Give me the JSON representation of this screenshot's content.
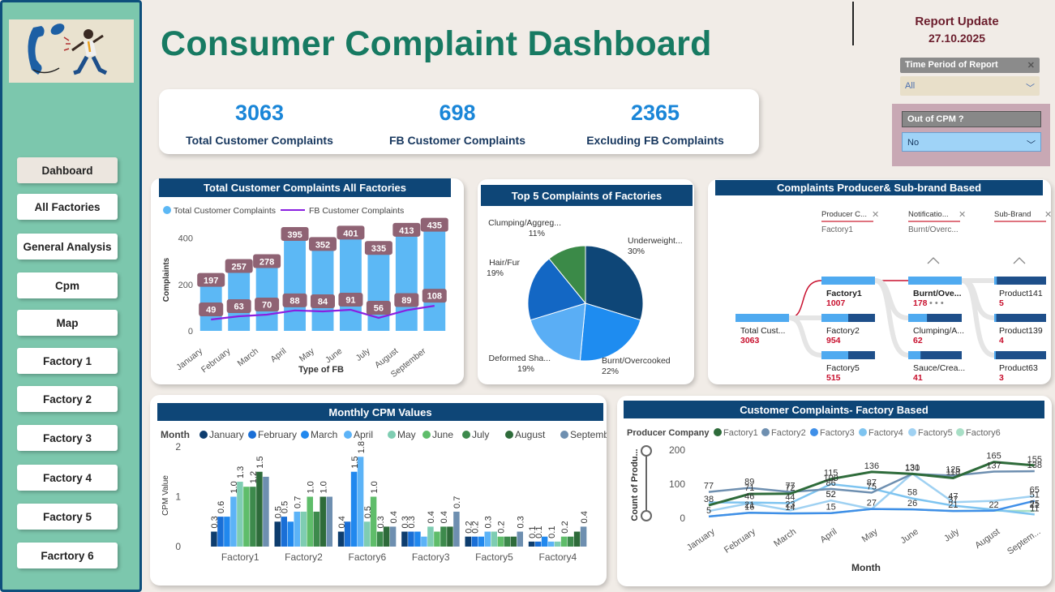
{
  "header": {
    "title": "Consumer Complaint Dashboard",
    "report_update_label": "Report Update",
    "report_date": "27.10.2025"
  },
  "nav": {
    "items": [
      "Dahboard",
      "All Factories",
      "General Analysis",
      "Cpm",
      "Map",
      "Factory 1",
      "Factory 2",
      "Factory 3",
      "Factory 4",
      "Factory 5",
      "Facrtory 6"
    ],
    "active": "Dahboard"
  },
  "slicers": {
    "time_period": {
      "label": "Time Period of Report",
      "value": "All"
    },
    "out_of_cpm": {
      "label": "Out of CPM ?",
      "value": "No"
    }
  },
  "kpis": [
    {
      "value": "3063",
      "label": "Total Customer Complaints"
    },
    {
      "value": "698",
      "label": "FB Customer Complaints"
    },
    {
      "value": "2365",
      "label": "Excluding FB Complaints"
    }
  ],
  "colors": {
    "title": "#177a62",
    "kpi_value": "#1a86d8",
    "header_bar": "#0e4677",
    "sidebar": "#7cc7ad",
    "report": "#6b1d2c"
  },
  "chart_data": [
    {
      "type": "bar",
      "title": "Total Customer Complaints All Factories",
      "xlabel": "Type of FB",
      "ylabel": "Complaints",
      "categories": [
        "January",
        "February",
        "March",
        "April",
        "May",
        "June",
        "July",
        "August",
        "September"
      ],
      "series": [
        {
          "name": "Total Customer Complaints",
          "values": [
            197,
            257,
            278,
            395,
            352,
            401,
            335,
            413,
            435
          ],
          "color": "#5cb8f5"
        },
        {
          "name": "FB Customer Complaints",
          "values": [
            49,
            63,
            70,
            88,
            84,
            91,
            56,
            89,
            108
          ],
          "color": "#8a1fe0",
          "type": "line"
        }
      ],
      "yticks": [
        0,
        200,
        400
      ],
      "ylim": [
        0,
        500
      ],
      "legend": "top-left"
    },
    {
      "type": "pie",
      "title": "Top 5 Complaints of Factories",
      "slices": [
        {
          "label": "Underweight...",
          "value": 30,
          "pct": "30%",
          "color": "#0e4677"
        },
        {
          "label": "Burnt/Overcooked",
          "value": 22,
          "pct": "22%",
          "color": "#1e8cf0"
        },
        {
          "label": "Deformed Sha...",
          "value": 19,
          "pct": "19%",
          "color": "#5aaef5"
        },
        {
          "label": "Hair/Fur",
          "value": 19,
          "pct": "19%",
          "color": "#1367c4"
        },
        {
          "label": "Clumping/Aggreg...",
          "value": 11,
          "pct": "11%",
          "color": "#3b8a48"
        }
      ]
    },
    {
      "type": "bar",
      "title": "Monthly CPM Values",
      "ylabel": "CPM Value",
      "legend_title": "Month",
      "categories": [
        "Factory1",
        "Factory2",
        "Factory6",
        "Factory3",
        "Factory5",
        "Factory4"
      ],
      "series": [
        {
          "name": "January",
          "color": "#0e3d6e",
          "values": [
            0.3,
            0.5,
            0.3,
            0.3,
            0.2,
            0.1
          ]
        },
        {
          "name": "February",
          "color": "#1a6fd6",
          "values": [
            0.6,
            0.6,
            0.5,
            0.3,
            0.2,
            0.1
          ]
        },
        {
          "name": "March",
          "color": "#2188ee",
          "values": [
            0.6,
            0.5,
            1.5,
            0.3,
            0.2,
            0.2
          ]
        },
        {
          "name": "April",
          "color": "#5cb3f7",
          "values": [
            1.0,
            0.7,
            1.8,
            0.2,
            0.3,
            0.1
          ]
        },
        {
          "name": "May",
          "color": "#7fcdb2",
          "values": [
            1.3,
            0.7,
            0.5,
            0.4,
            0.3,
            0.1
          ]
        },
        {
          "name": "June",
          "color": "#5fbd6a",
          "values": [
            1.2,
            1.0,
            1.0,
            0.3,
            0.2,
            0.2
          ]
        },
        {
          "name": "July",
          "color": "#3d8a4c",
          "values": [
            1.2,
            0.7,
            0.3,
            0.4,
            0.2,
            0.2
          ]
        },
        {
          "name": "August",
          "color": "#2e6b3a",
          "values": [
            1.5,
            1.0,
            0.4,
            0.4,
            0.2,
            0.3
          ]
        },
        {
          "name": "September",
          "color": "#6e8fb0",
          "values": [
            1.4,
            1.0,
            0.4,
            0.7,
            0.3,
            0.4
          ]
        }
      ],
      "bar_labels": [
        {
          "cat": "Factory1",
          "series": "January",
          "text": "0.3"
        },
        {
          "cat": "Factory1",
          "series": "February",
          "text": "0.6"
        },
        {
          "cat": "Factory1",
          "series": "April",
          "text": "1.0"
        },
        {
          "cat": "Factory1",
          "series": "May",
          "text": "1.3"
        },
        {
          "cat": "Factory1",
          "series": "July",
          "text": "1.2"
        },
        {
          "cat": "Factory1",
          "series": "August",
          "text": "1.5"
        },
        {
          "cat": "Factory2",
          "series": "January",
          "text": "0.5"
        },
        {
          "cat": "Factory2",
          "series": "February",
          "text": "0.5"
        },
        {
          "cat": "Factory2",
          "series": "April",
          "text": "0.7"
        },
        {
          "cat": "Factory2",
          "series": "June",
          "text": "1.0"
        },
        {
          "cat": "Factory2",
          "series": "August",
          "text": "1.0"
        },
        {
          "cat": "Factory6",
          "series": "January",
          "text": "0.4"
        },
        {
          "cat": "Factory6",
          "series": "March",
          "text": "1.5"
        },
        {
          "cat": "Factory6",
          "series": "April",
          "text": "1.8"
        },
        {
          "cat": "Factory6",
          "series": "May",
          "text": "0.5"
        },
        {
          "cat": "Factory6",
          "series": "June",
          "text": "1.0"
        },
        {
          "cat": "Factory6",
          "series": "July",
          "text": "0.3"
        },
        {
          "cat": "Factory6",
          "series": "September",
          "text": "0.4"
        },
        {
          "cat": "Factory3",
          "series": "January",
          "text": "0.3"
        },
        {
          "cat": "Factory3",
          "series": "February",
          "text": "0.3"
        },
        {
          "cat": "Factory3",
          "series": "May",
          "text": "0.4"
        },
        {
          "cat": "Factory3",
          "series": "July",
          "text": "0.4"
        },
        {
          "cat": "Factory3",
          "series": "September",
          "text": "0.7"
        },
        {
          "cat": "Factory5",
          "series": "January",
          "text": "0.2"
        },
        {
          "cat": "Factory5",
          "series": "February",
          "text": "0.2"
        },
        {
          "cat": "Factory5",
          "series": "April",
          "text": "0.3"
        },
        {
          "cat": "Factory5",
          "series": "June",
          "text": "0.2"
        },
        {
          "cat": "Factory5",
          "series": "September",
          "text": "0.3"
        },
        {
          "cat": "Factory4",
          "series": "January",
          "text": "0.1"
        },
        {
          "cat": "Factory4",
          "series": "February",
          "text": "0.1"
        },
        {
          "cat": "Factory4",
          "series": "April",
          "text": "0.1"
        },
        {
          "cat": "Factory4",
          "series": "June",
          "text": "0.2"
        },
        {
          "cat": "Factory4",
          "series": "September",
          "text": "0.4"
        }
      ],
      "yticks": [
        0,
        1,
        2
      ],
      "ylim": [
        0,
        2
      ],
      "legend": "top"
    },
    {
      "type": "line",
      "title": "Customer Complaints- Factory Based",
      "xlabel": "Month",
      "ylabel": "Count of Produ...",
      "legend_title": "Producer Company",
      "categories": [
        "January",
        "February",
        "March",
        "April",
        "May",
        "June",
        "July",
        "August",
        "Septem..."
      ],
      "series": [
        {
          "name": "Factory1",
          "color": "#2e6b3a",
          "values": [
            38,
            71,
            72,
            115,
            136,
            130,
            118,
            165,
            155
          ]
        },
        {
          "name": "Factory2",
          "color": "#6e8fb0",
          "values": [
            77,
            89,
            77,
            86,
            75,
            130,
            125,
            137,
            138
          ]
        },
        {
          "name": "Factory3",
          "color": "#3f8fe8",
          "values": [
            5,
            16,
            14,
            15,
            27,
            26,
            21,
            22,
            51
          ]
        },
        {
          "name": "Factory4",
          "color": "#7ec4f0",
          "values": [
            46,
            46,
            44,
            100,
            87,
            58,
            37,
            25,
            11
          ]
        },
        {
          "name": "Factory5",
          "color": "#9fd1f2",
          "values": [
            21,
            44,
            23,
            52,
            27,
            131,
            47,
            51,
            65
          ]
        },
        {
          "name": "Factory6",
          "color": "#a8dfc6",
          "values": [
            5,
            16,
            14,
            15,
            27,
            26,
            21,
            22,
            21
          ]
        }
      ],
      "point_labels": [
        {
          "i": 0,
          "text": "38",
          "v": 38
        },
        {
          "i": 0,
          "text": "5",
          "v": 5
        },
        {
          "i": 0,
          "text": "77",
          "v": 77
        },
        {
          "i": 1,
          "text": "71",
          "v": 71
        },
        {
          "i": 1,
          "text": "46",
          "v": 46
        },
        {
          "i": 1,
          "text": "21",
          "v": 21
        },
        {
          "i": 1,
          "text": "16",
          "v": 16
        },
        {
          "i": 1,
          "text": "89",
          "v": 89
        },
        {
          "i": 2,
          "text": "72",
          "v": 72
        },
        {
          "i": 2,
          "text": "23",
          "v": 23
        },
        {
          "i": 2,
          "text": "44",
          "v": 44
        },
        {
          "i": 2,
          "text": "14",
          "v": 14
        },
        {
          "i": 2,
          "text": "77",
          "v": 77
        },
        {
          "i": 3,
          "text": "115",
          "v": 115
        },
        {
          "i": 3,
          "text": "86",
          "v": 86
        },
        {
          "i": 3,
          "text": "52",
          "v": 52
        },
        {
          "i": 3,
          "text": "15",
          "v": 15
        },
        {
          "i": 3,
          "text": "52",
          "v": 52
        },
        {
          "i": 3,
          "text": "100",
          "v": 100
        },
        {
          "i": 4,
          "text": "75",
          "v": 75
        },
        {
          "i": 4,
          "text": "136",
          "v": 136
        },
        {
          "i": 4,
          "text": "27",
          "v": 27
        },
        {
          "i": 4,
          "text": "87",
          "v": 87
        },
        {
          "i": 5,
          "text": "130",
          "v": 130
        },
        {
          "i": 5,
          "text": "58",
          "v": 58
        },
        {
          "i": 5,
          "text": "131",
          "v": 131
        },
        {
          "i": 5,
          "text": "26",
          "v": 26
        },
        {
          "i": 6,
          "text": "118",
          "v": 118
        },
        {
          "i": 6,
          "text": "37",
          "v": 37
        },
        {
          "i": 6,
          "text": "47",
          "v": 47
        },
        {
          "i": 6,
          "text": "125",
          "v": 125
        },
        {
          "i": 6,
          "text": "21",
          "v": 21
        },
        {
          "i": 7,
          "text": "165",
          "v": 165
        },
        {
          "i": 7,
          "text": "137",
          "v": 137
        },
        {
          "i": 7,
          "text": "22",
          "v": 22
        },
        {
          "i": 8,
          "text": "138",
          "v": 138
        },
        {
          "i": 8,
          "text": "65",
          "v": 65
        },
        {
          "i": 8,
          "text": "155",
          "v": 155
        },
        {
          "i": 8,
          "text": "11",
          "v": 11
        },
        {
          "i": 8,
          "text": "51",
          "v": 51
        },
        {
          "i": 8,
          "text": "25",
          "v": 25
        },
        {
          "i": 8,
          "text": "21",
          "v": 21
        }
      ],
      "yticks": [
        0,
        100,
        200
      ],
      "ylim": [
        0,
        200
      ],
      "legend": "top"
    }
  ],
  "decomp": {
    "title": "Complaints Producer& Sub-brand Based",
    "levels": [
      {
        "header": "Producer C...",
        "selected": "Factory1"
      },
      {
        "header": "Notificatio...",
        "selected": "Burnt/Overc..."
      },
      {
        "header": "Sub-Brand",
        "selected": ""
      }
    ],
    "root": {
      "label": "Total Cust...",
      "value": "3063",
      "frac": 1.0
    },
    "col1": [
      {
        "label": "Factory1",
        "value": "1007",
        "frac": 1.0,
        "bold": true
      },
      {
        "label": "Factory2",
        "value": "954",
        "frac": 0.5
      },
      {
        "label": "Factory5",
        "value": "515",
        "frac": 0.5
      }
    ],
    "col2": [
      {
        "label": "Burnt/Ove...",
        "value": "178",
        "frac": 1.0,
        "bold": true
      },
      {
        "label": "Clumping/A...",
        "value": "62",
        "frac": 0.35
      },
      {
        "label": "Sauce/Crea...",
        "value": "41",
        "frac": 0.23
      }
    ],
    "col3": [
      {
        "label": "Product141",
        "value": "5",
        "frac": 0.05
      },
      {
        "label": "Product139",
        "value": "4",
        "frac": 0.04
      },
      {
        "label": "Product63",
        "value": "3",
        "frac": 0.03
      }
    ]
  }
}
